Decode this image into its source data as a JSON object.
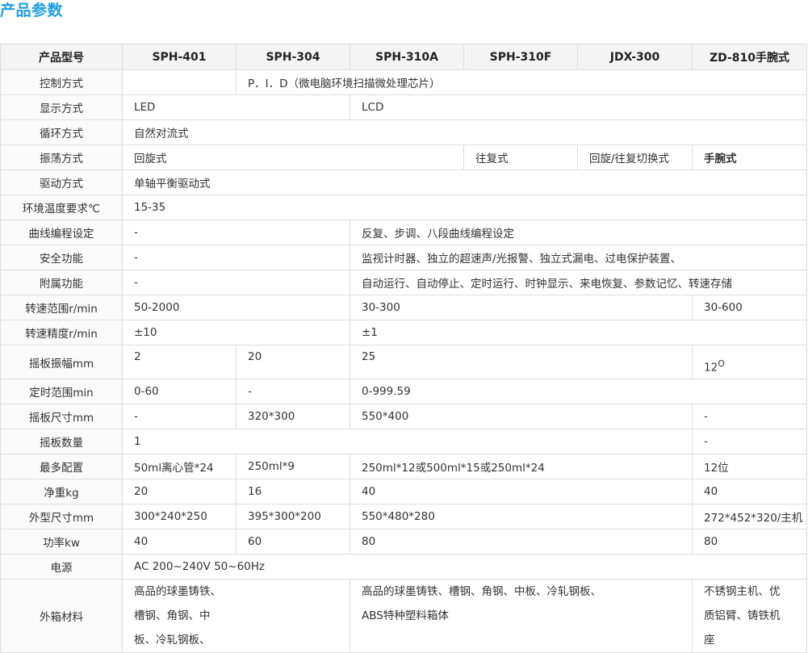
{
  "section_title": "产品参数",
  "headers": [
    "产品型号",
    "SPH-401",
    "SPH-304",
    "SPH-310A",
    "SPH-310F",
    "JDX-300",
    "ZD-810手腕式"
  ],
  "rows": {
    "control": {
      "label": "控制方式",
      "c1": "",
      "c2": "P．I．D（微电脑环境扫描微处理芯片）"
    },
    "display": {
      "label": "显示方式",
      "c1": "LED",
      "c2": "LCD"
    },
    "circulation": {
      "label": "循环方式",
      "c1": "自然对流式"
    },
    "oscillation": {
      "label": "振荡方式",
      "c1": "回旋式",
      "c2": "往复式",
      "c3": "回旋/往复切换式",
      "c4": "手腕式"
    },
    "drive": {
      "label": "驱动方式",
      "c1": "单轴平衡驱动式"
    },
    "ambient": {
      "label": "环境温度要求℃",
      "c1": "15-35"
    },
    "program": {
      "label": "曲线编程设定",
      "c1": "-",
      "c2": "反复、步调、八段曲线编程设定"
    },
    "safety": {
      "label": "安全功能",
      "c1": "-",
      "c2": "监视计时器、独立的超速声/光报警、独立式漏电、过电保护装置、"
    },
    "aux": {
      "label": "附属功能",
      "c1": "-",
      "c2": "自动运行、自动停止、定时运行、时钟显示、来电恢复、参数记忆、转速存储"
    },
    "speed_range": {
      "label": "转速范围r/min",
      "c1": "50-2000",
      "c2": "30-300",
      "c3": "30-600"
    },
    "speed_precision": {
      "label": "转速精度r/min",
      "c1": "±10",
      "c2": "±1"
    },
    "amplitude": {
      "label": "摇板振幅mm",
      "c1": "2",
      "c2": "20",
      "c3": "25",
      "c4": "12",
      "c4_sup": "O"
    },
    "timer": {
      "label": "定时范围min",
      "c1": "0-60",
      "c2": "-",
      "c3": "0-999.59"
    },
    "plate_size": {
      "label": "摇板尺寸mm",
      "c1": "-",
      "c2": "320*300",
      "c3": "550*400",
      "c4": "-"
    },
    "plate_qty": {
      "label": "摇板数量",
      "c1": "1",
      "c2": "-"
    },
    "max_config": {
      "label": "最多配置",
      "c1": "50ml离心管*24",
      "c2": "250ml*9",
      "c3": "250ml*12或500ml*15或250ml*24",
      "c4": "12位"
    },
    "weight": {
      "label": "净重kg",
      "c1": "20",
      "c2": "16",
      "c3": "40",
      "c4": "40"
    },
    "dimensions": {
      "label": "外型尺寸mm",
      "c1": "300*240*250",
      "c2": "395*300*200",
      "c3": "550*480*280",
      "c4": "272*452*320/主机"
    },
    "power": {
      "label": "功率kw",
      "c1": "40",
      "c2": "60",
      "c3": "80",
      "c4": "80"
    },
    "supply": {
      "label": "电源",
      "c1": "AC 200~240V 50~60Hz"
    },
    "material": {
      "label": "外箱材料",
      "c1": "高品的球墨铸铁、槽钢、角钢、中板、冷轧钢板、",
      "c2": "高品的球墨铸铁、槽钢、角钢、中板、冷轧钢板、ABS特种塑料箱体",
      "c3": "不锈钢主机、优质铝臂、铸铁机座"
    }
  }
}
